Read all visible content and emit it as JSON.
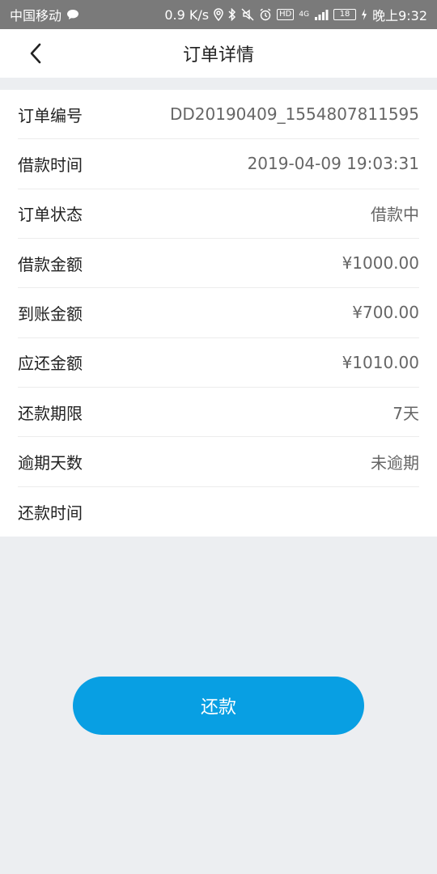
{
  "status_bar": {
    "carrier": "中国移动",
    "speed": "0.9 K/s",
    "hd": "HD",
    "network": "4G",
    "battery": "18",
    "time": "晚上9:32"
  },
  "nav": {
    "title": "订单详情"
  },
  "details": [
    {
      "label": "订单编号",
      "value": "DD20190409_1554807811595"
    },
    {
      "label": "借款时间",
      "value": "2019-04-09 19:03:31"
    },
    {
      "label": "订单状态",
      "value": "借款中"
    },
    {
      "label": "借款金额",
      "value": "¥1000.00"
    },
    {
      "label": "到账金额",
      "value": "¥700.00"
    },
    {
      "label": "应还金额",
      "value": "¥1010.00"
    },
    {
      "label": "还款期限",
      "value": "7天"
    },
    {
      "label": "逾期天数",
      "value": "未逾期"
    },
    {
      "label": "还款时间",
      "value": ""
    }
  ],
  "repay_button": {
    "label": "还款"
  },
  "colors": {
    "accent": "#089fe3",
    "status_bar": "#7a7a7a",
    "page_bg": "#eceef1"
  }
}
